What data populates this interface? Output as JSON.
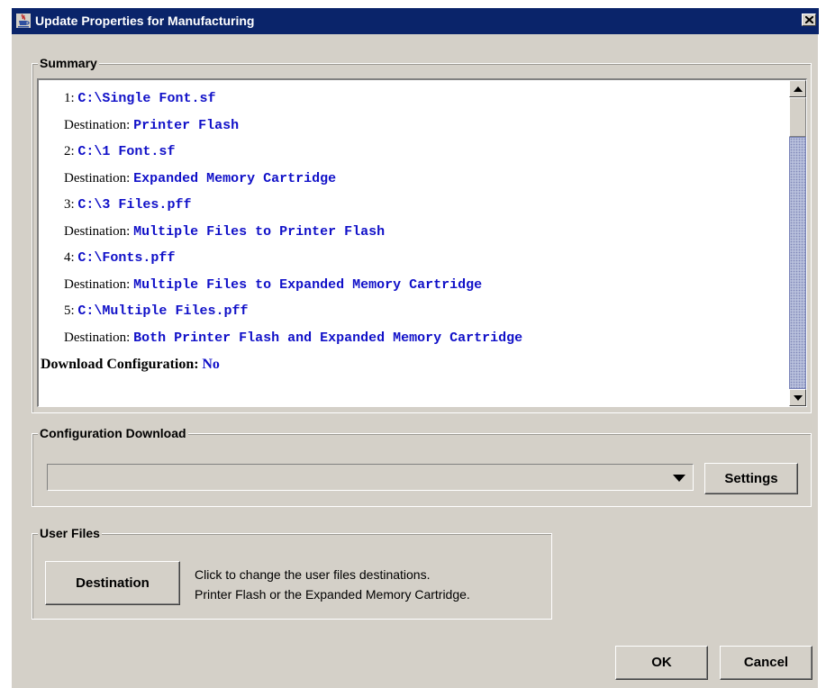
{
  "window": {
    "title": "Update Properties for Manufacturing",
    "icon": "java-cup-icon",
    "close_icon": "close-icon"
  },
  "summary": {
    "group_label": "Summary",
    "items": [
      {
        "index": "1:",
        "path": "C:\\Single Font.sf",
        "destination_label": "Destination:",
        "destination": "Printer Flash"
      },
      {
        "index": "2:",
        "path": "C:\\1 Font.sf",
        "destination_label": "Destination:",
        "destination": "Expanded Memory Cartridge"
      },
      {
        "index": "3:",
        "path": "C:\\3 Files.pff",
        "destination_label": "Destination:",
        "destination": "Multiple Files to Printer Flash"
      },
      {
        "index": "4:",
        "path": "C:\\Fonts.pff",
        "destination_label": "Destination:",
        "destination": "Multiple Files to Expanded Memory Cartridge"
      },
      {
        "index": "5:",
        "path": "C:\\Multiple Files.pff",
        "destination_label": "Destination:",
        "destination": "Both Printer Flash and Expanded Memory Cartridge"
      }
    ],
    "download_config_label": "Download Configuration:",
    "download_config_value": "No"
  },
  "config_download": {
    "group_label": "Configuration Download",
    "combo_value": "",
    "settings_label": "Settings"
  },
  "user_files": {
    "group_label": "User Files",
    "destination_label": "Destination",
    "description_line1": "Click to change the user files destinations.",
    "description_line2": "Printer Flash or the Expanded Memory Cartridge."
  },
  "footer": {
    "ok_label": "OK",
    "cancel_label": "Cancel"
  },
  "colors": {
    "title_bar": "#0a246a",
    "dialog_bg": "#d4d0c8",
    "value_text": "#1010c8"
  }
}
